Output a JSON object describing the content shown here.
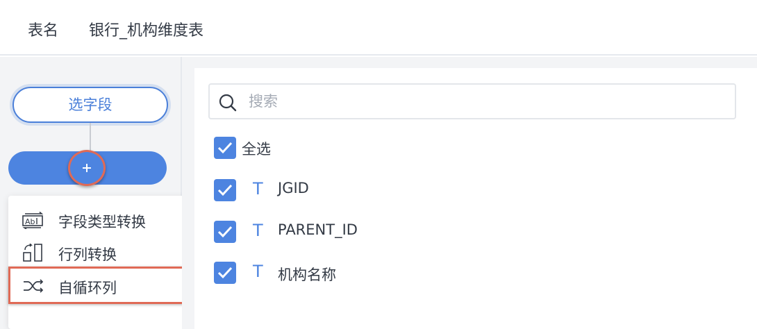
{
  "header": {
    "label": "表名",
    "value": "银行_机构维度表"
  },
  "flow": {
    "select_node_label": "选字段",
    "add_button_symbol": "+"
  },
  "menu": {
    "items": [
      {
        "label": "字段类型转换",
        "icon": "field-type-convert-icon"
      },
      {
        "label": "行列转换",
        "icon": "row-column-transpose-icon"
      },
      {
        "label": "自循环列",
        "icon": "shuffle-loop-icon"
      }
    ],
    "highlighted_item": "自循环列"
  },
  "fields": {
    "search_placeholder": "搜索",
    "select_all_label": "全选",
    "select_all_checked": true,
    "items": [
      {
        "type_icon": "T",
        "name": "JGID",
        "checked": true
      },
      {
        "type_icon": "T",
        "name": "PARENT_ID",
        "checked": true
      },
      {
        "type_icon": "T",
        "name": "机构名称",
        "checked": true
      }
    ]
  },
  "colors": {
    "accent": "#4d84e0",
    "highlight": "#e06a56",
    "background": "#f3f4f6"
  }
}
